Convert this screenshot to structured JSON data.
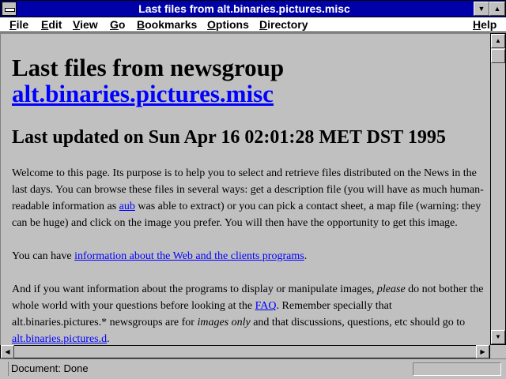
{
  "window": {
    "title": "Last files from alt.binaries.pictures.misc"
  },
  "menubar": {
    "items": [
      "File",
      "Edit",
      "View",
      "Go",
      "Bookmarks",
      "Options",
      "Directory",
      "Help"
    ]
  },
  "page": {
    "heading_prefix": "Last files from newsgroup",
    "heading_link": "alt.binaries.pictures.misc",
    "subheading": "Last updated on Sun Apr 16 02:01:28 MET DST 1995",
    "para1": {
      "text_a": "Welcome to this page. Its purpose is to help you to select and retrieve files distributed on the News in the last days. You can browse these files in several ways: get a description file (you will have as much human-readable information as ",
      "link_aub": "aub",
      "text_b": " was able to extract) or you can pick a contact sheet, a map file (warning: they can be huge) and click on the image you prefer. You will then have the opportunity to get this image."
    },
    "para2": {
      "text_a": "You can have ",
      "link_info": "information about the Web and the clients programs",
      "text_b": "."
    },
    "para3": {
      "text_a": "And if you want information about the programs to display or manipulate images, ",
      "em_please": "please",
      "text_b": " do not bother the whole world with your questions before looking at the ",
      "link_faq": "FAQ",
      "text_c": ". Remember specially that alt.binaries.pictures.* newsgroups are for ",
      "em_images": "images only",
      "text_d": " and that discussions, questions, etc should go to ",
      "link_d": "alt.binaries.pictures.d",
      "text_e": "."
    }
  },
  "status": {
    "text": "Document: Done",
    "progress": 0
  },
  "icons": {
    "up_arrow": "▲",
    "down_arrow": "▼",
    "left_arrow": "◀",
    "right_arrow": "▶",
    "minimize": "▼",
    "maximize": "▲"
  },
  "colors": {
    "titlebar": "#0000a8",
    "link": "#0000ff",
    "background": "#c0c0c0"
  }
}
